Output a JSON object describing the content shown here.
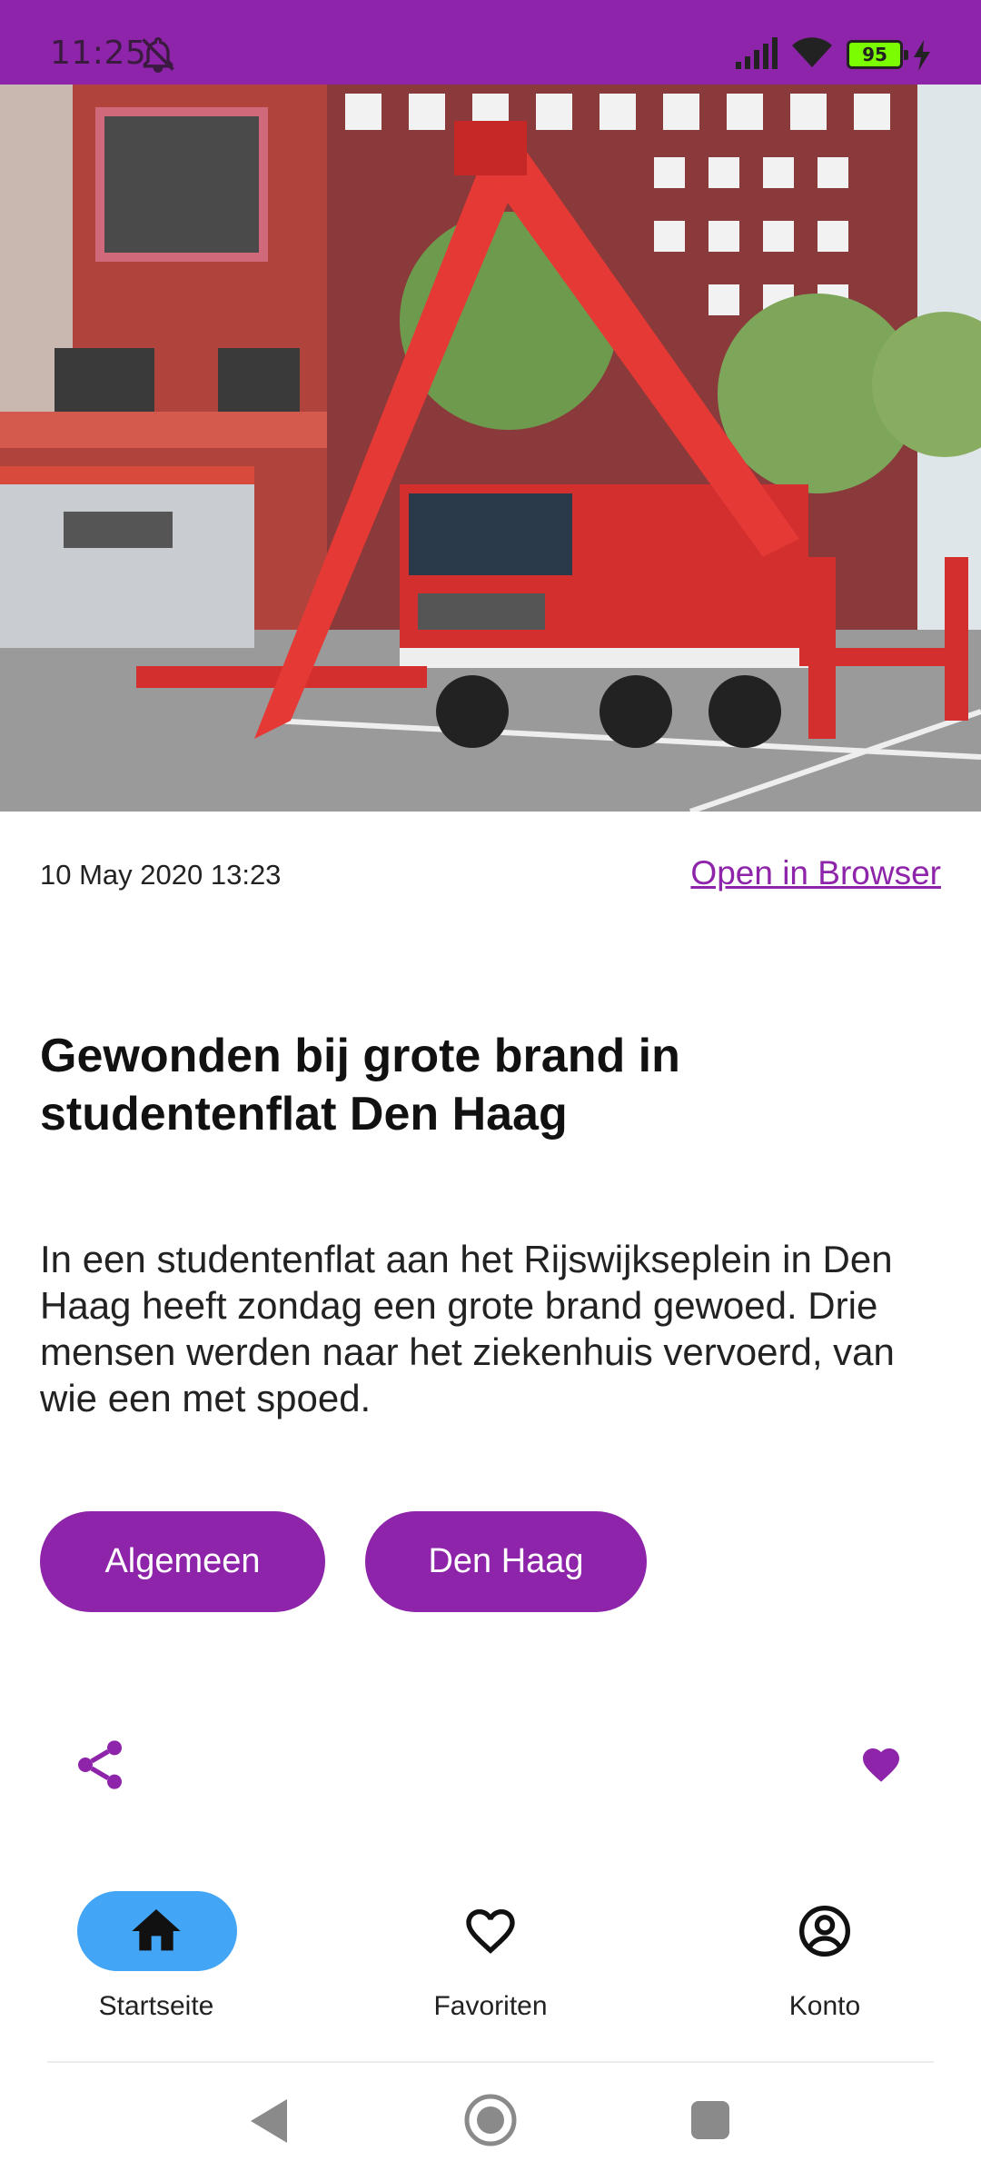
{
  "status_bar": {
    "time": "11:25",
    "battery": "95",
    "icons": [
      "bell-off-icon",
      "signal-icon",
      "wifi-icon",
      "battery-icon",
      "charging-icon"
    ]
  },
  "article": {
    "hero_image": "fire-truck-aerial-ladder-photo",
    "date": "10 May 2020 13:23",
    "open_in_browser": "Open in Browser",
    "title": "Gewonden bij grote brand in studentenflat Den Haag",
    "body": "In een studentenflat aan het Rijswijkseplein in Den Haag heeft zondag een grote brand gewoed. Drie mensen werden naar het ziekenhuis vervoerd, van wie een met spoed.",
    "tags": [
      "Algemeen",
      "Den Haag"
    ],
    "actions": [
      "share-icon",
      "heart-icon"
    ]
  },
  "bottom_nav": {
    "items": [
      {
        "label": "Startseite",
        "icon": "home-icon",
        "active": true
      },
      {
        "label": "Favoriten",
        "icon": "heart-outline-icon",
        "active": false
      },
      {
        "label": "Konto",
        "icon": "account-icon",
        "active": false
      }
    ]
  },
  "colors": {
    "accent": "#8e24aa",
    "active_nav": "#42a5f5"
  }
}
